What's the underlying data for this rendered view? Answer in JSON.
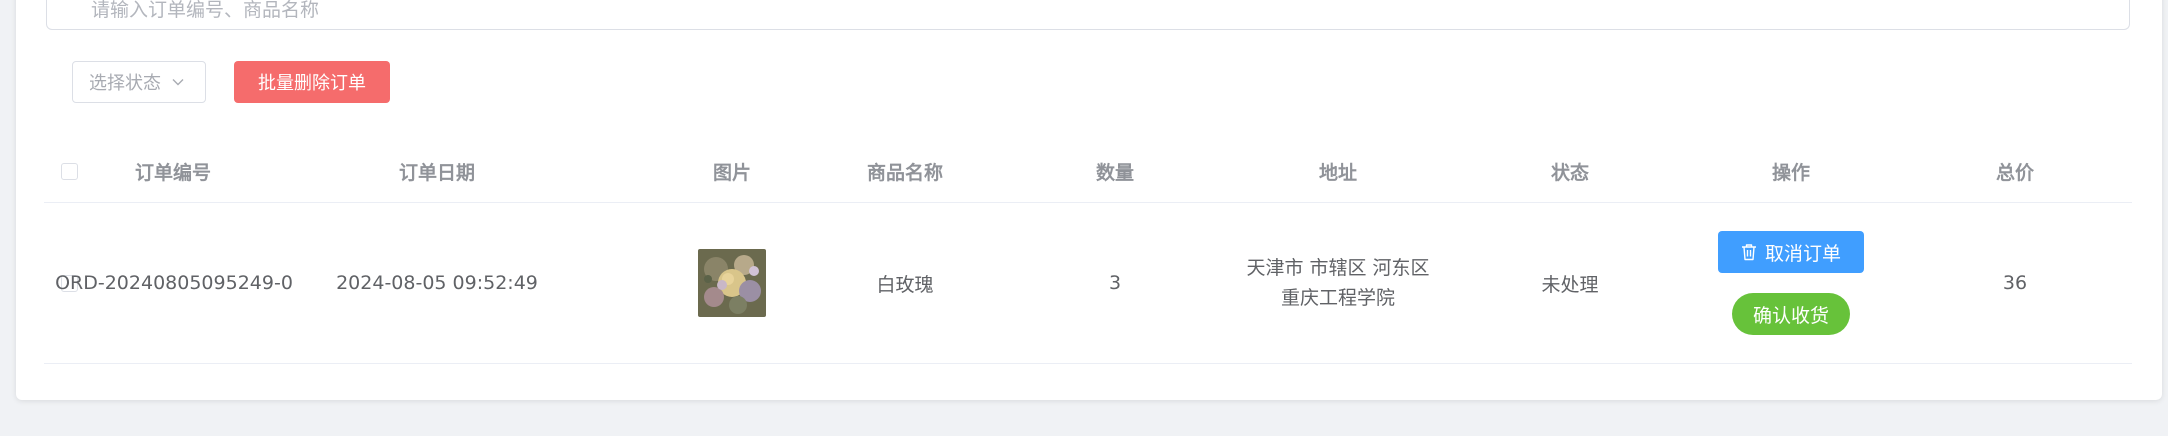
{
  "search": {
    "placeholder": "请输入订单编号、商品名称"
  },
  "toolbar": {
    "status_select_placeholder": "选择状态",
    "batch_delete_label": "批量删除订单"
  },
  "table": {
    "headers": {
      "order_no": "订单编号",
      "order_date": "订单日期",
      "image": "图片",
      "product_name": "商品名称",
      "quantity": "数量",
      "address": "地址",
      "status": "状态",
      "actions": "操作",
      "total": "总价"
    },
    "rows": [
      {
        "order_no": "ORD-20240805095249-0",
        "order_date": "2024-08-05 09:52:49",
        "product_name": "白玫瑰",
        "quantity": "3",
        "address_line1": "天津市 市辖区 河东区",
        "address_line2": "重庆工程学院",
        "status": "未处理",
        "cancel_label": "取消订单",
        "confirm_label": "确认收货",
        "total": "36"
      }
    ]
  },
  "colors": {
    "danger": "#f56c6c",
    "primary": "#409eff",
    "success": "#67c23a"
  }
}
